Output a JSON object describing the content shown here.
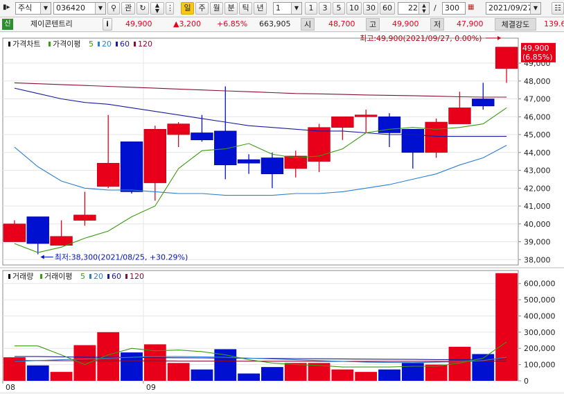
{
  "toolbar": {
    "market": "주식",
    "code": "036420",
    "watch_label": "관",
    "period_buttons": [
      "일",
      "주",
      "월",
      "분",
      "틱",
      "년"
    ],
    "active_period": "일",
    "interval_value": "1",
    "interval_buttons": [
      "1",
      "3",
      "5",
      "10",
      "30",
      "60"
    ],
    "count_value": "22",
    "separator": "/",
    "total_value": "300",
    "date_value": "2021/09/27"
  },
  "info": {
    "credit_badge": "신",
    "name": "제이콘텐트리",
    "info_button": "i",
    "price": "49,900",
    "change": "▲3,200",
    "change_rate": "+6.85%",
    "volume": "663,905",
    "open_label": "시",
    "open": "48,700",
    "high_label": "고",
    "high": "49,900",
    "low_label": "저",
    "low": "47,900",
    "strength_label": "체결강도",
    "strength": "139.6"
  },
  "colors": {
    "up": "#e8001a",
    "down": "#0010d0",
    "ma5": "#3a9a10",
    "ma20": "#2a7fd0",
    "ma60": "#1a1aa0",
    "ma120": "#8a0d30"
  },
  "chart_data": [
    {
      "type": "candlestick",
      "legend": {
        "title": "가격차트",
        "ma_label": "가격이평",
        "periods": [
          "5",
          "20",
          "60",
          "120"
        ]
      },
      "ylim": [
        37700,
        50400
      ],
      "y_ticks": [
        "38,000",
        "39,000",
        "40,000",
        "41,000",
        "42,000",
        "43,000",
        "44,000",
        "45,000",
        "46,000",
        "47,000",
        "48,000",
        "49,000"
      ],
      "x_labels": [
        {
          "index": 0,
          "label": "08"
        },
        {
          "index": 6,
          "label": "09"
        }
      ],
      "candles": [
        {
          "o": 39000,
          "h": 40200,
          "l": 39000,
          "c": 40000
        },
        {
          "o": 40400,
          "h": 40400,
          "l": 38300,
          "c": 38900
        },
        {
          "o": 38800,
          "h": 40200,
          "l": 38800,
          "c": 39300
        },
        {
          "o": 40200,
          "h": 41800,
          "l": 39900,
          "c": 40500
        },
        {
          "o": 42100,
          "h": 46100,
          "l": 42000,
          "c": 43400
        },
        {
          "o": 44600,
          "h": 44600,
          "l": 41700,
          "c": 41800
        },
        {
          "o": 42300,
          "h": 45500,
          "l": 41300,
          "c": 45300
        },
        {
          "o": 45000,
          "h": 45700,
          "l": 44300,
          "c": 45600
        },
        {
          "o": 45100,
          "h": 46100,
          "l": 44600,
          "c": 44700
        },
        {
          "o": 45200,
          "h": 47700,
          "l": 42500,
          "c": 43300
        },
        {
          "o": 43600,
          "h": 43900,
          "l": 42800,
          "c": 43400
        },
        {
          "o": 43700,
          "h": 44000,
          "l": 42000,
          "c": 42800
        },
        {
          "o": 43100,
          "h": 44100,
          "l": 42600,
          "c": 43800
        },
        {
          "o": 43500,
          "h": 45600,
          "l": 42900,
          "c": 45400
        },
        {
          "o": 45400,
          "h": 46000,
          "l": 44700,
          "c": 46000
        },
        {
          "o": 46000,
          "h": 46400,
          "l": 45100,
          "c": 46100
        },
        {
          "o": 46000,
          "h": 46200,
          "l": 44300,
          "c": 45100
        },
        {
          "o": 45300,
          "h": 45300,
          "l": 43100,
          "c": 44000
        },
        {
          "o": 44000,
          "h": 45900,
          "l": 43700,
          "c": 45700
        },
        {
          "o": 45600,
          "h": 47400,
          "l": 45600,
          "c": 46500
        },
        {
          "o": 47000,
          "h": 47900,
          "l": 46400,
          "c": 46600
        },
        {
          "o": 48700,
          "h": 49900,
          "l": 47900,
          "c": 49900
        }
      ],
      "ma5": [
        38900,
        38400,
        38700,
        39200,
        39600,
        40400,
        41000,
        43100,
        44100,
        44200,
        44500,
        43900,
        43700,
        43800,
        44200,
        45100,
        45300,
        45400,
        45300,
        45400,
        45600,
        46500
      ],
      "ma20": [
        44300,
        43200,
        42400,
        42000,
        41900,
        41900,
        41800,
        41700,
        41700,
        41600,
        41600,
        41600,
        41700,
        41700,
        41800,
        42000,
        42200,
        42500,
        42800,
        43300,
        43700,
        44400
      ],
      "ma60": [
        47600,
        47300,
        47000,
        46800,
        46700,
        46500,
        46300,
        46100,
        45900,
        45700,
        45500,
        45400,
        45300,
        45200,
        45200,
        45100,
        45000,
        45000,
        44900,
        44900,
        44900,
        44900
      ],
      "ma120": [
        47900,
        47850,
        47800,
        47750,
        47700,
        47650,
        47600,
        47550,
        47500,
        47450,
        47400,
        47350,
        47300,
        47280,
        47250,
        47220,
        47200,
        47180,
        47150,
        47120,
        47100,
        47100
      ],
      "annotations": {
        "high_label": "최고:49,900(2021/09/27, 0.00%)",
        "low_label": "최저:38,300(2021/08/25, +30.29%)",
        "last_price": "49,900",
        "last_rate": "(6.85%)"
      }
    },
    {
      "type": "bar",
      "legend": {
        "title": "거래량",
        "ma_label": "거래이평",
        "periods": [
          "5",
          "20",
          "60",
          "120"
        ]
      },
      "ylim": [
        0,
        680000
      ],
      "y_ticks": [
        "0",
        "100,000",
        "200,000",
        "300,000",
        "400,000",
        "500,000",
        "600,000"
      ],
      "values": [
        145000,
        95000,
        55000,
        220000,
        300000,
        175000,
        225000,
        110000,
        70000,
        195000,
        45000,
        85000,
        110000,
        110000,
        70000,
        55000,
        70000,
        110000,
        100000,
        210000,
        165000,
        663905
      ],
      "ma5": [
        215000,
        215000,
        160000,
        100000,
        160000,
        200000,
        185000,
        190000,
        180000,
        160000,
        130000,
        110000,
        100000,
        95000,
        85000,
        85000,
        85000,
        90000,
        90000,
        110000,
        140000,
        240000
      ],
      "ma20": [
        120000,
        125000,
        130000,
        135000,
        140000,
        145000,
        150000,
        150000,
        148000,
        145000,
        140000,
        135000,
        130000,
        125000,
        120000,
        115000,
        113000,
        112000,
        115000,
        118000,
        125000,
        145000
      ],
      "ma60": [
        150000,
        150000,
        148000,
        146000,
        145000,
        144000,
        143000,
        142000,
        141000,
        140000,
        139000,
        138000,
        137000,
        136000,
        135000,
        134000,
        133000,
        132000,
        131000,
        131000,
        132000,
        135000
      ],
      "ma120": [
        125000,
        125000,
        124000,
        124000,
        123000,
        123000,
        123000,
        122000,
        122000,
        122000,
        121000,
        121000,
        121000,
        120000,
        120000,
        120000,
        120000,
        120000,
        120000,
        120000,
        121000,
        122000
      ]
    }
  ]
}
